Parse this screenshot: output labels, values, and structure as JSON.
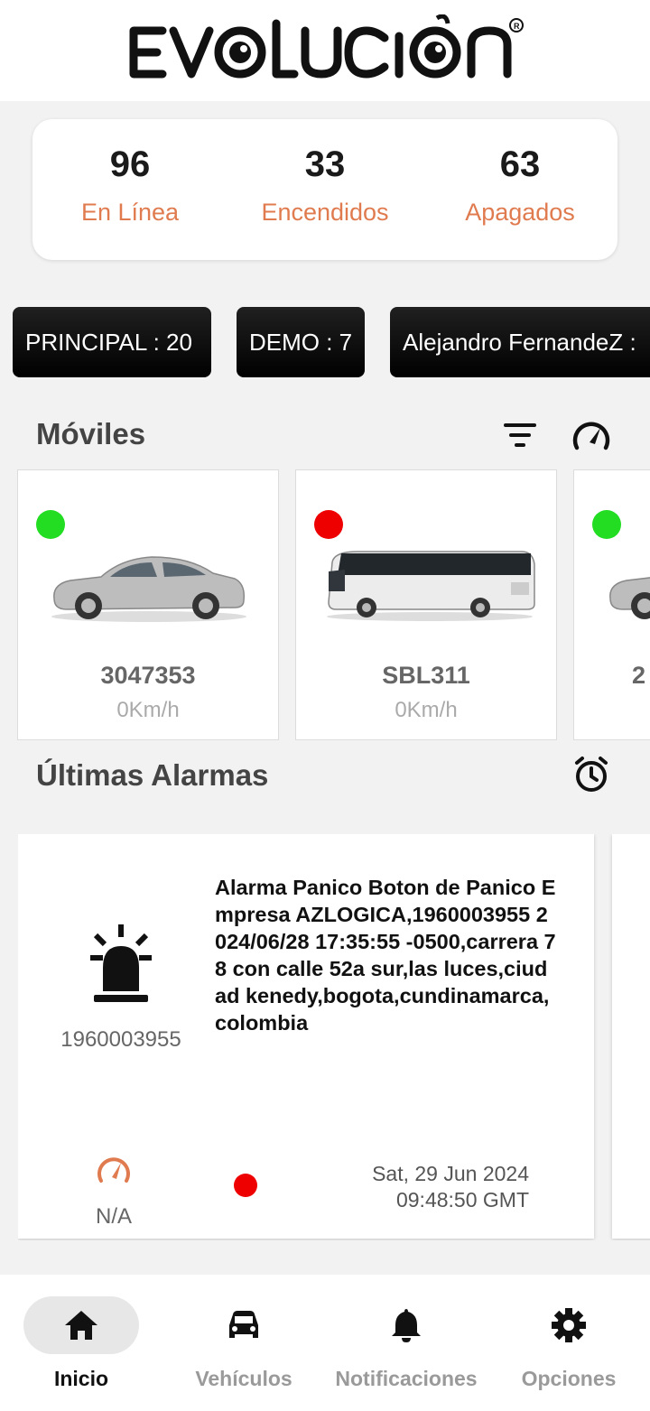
{
  "brand": {
    "logo_text": "EVOLUCIÓN",
    "accent": "#e07b4f"
  },
  "stats": [
    {
      "value": "96",
      "label": "En Línea"
    },
    {
      "value": "33",
      "label": "Encendidos"
    },
    {
      "value": "63",
      "label": "Apagados"
    }
  ],
  "groups": [
    {
      "label": "PRINCIPAL : 20"
    },
    {
      "label": "DEMO : 7"
    },
    {
      "label": "Alejandro FernandeZ :"
    }
  ],
  "mobiles": {
    "title": "Móviles",
    "filter_icon": "filter-icon",
    "speed_icon": "speedometer-icon",
    "items": [
      {
        "plate": "3047353",
        "speed": "0Km/h",
        "status_color": "#22dd22",
        "type": "car"
      },
      {
        "plate": "SBL311",
        "speed": "0Km/h",
        "status_color": "#ee0000",
        "type": "bus"
      },
      {
        "plate": "2",
        "speed": "",
        "status_color": "#22dd22",
        "type": "car"
      }
    ]
  },
  "alarms": {
    "title": "Últimas Alarmas",
    "clock_icon": "alarm-clock-icon",
    "items": [
      {
        "id": "1960003955",
        "text": "Alarma Panico Boton de Panico Empresa AZLOGICA,1960003955 2024/06/28 17:35:55 -0500,carrera 78 con calle 52a sur,las luces,ciudad kenedy,bogota,cundinamarca,colombia",
        "speed": "N/A",
        "date_line1": "Sat, 29 Jun 2024",
        "date_line2": "09:48:50 GMT",
        "status_color": "#ee0000"
      }
    ]
  },
  "nav": [
    {
      "label": "Inicio",
      "icon": "home-icon",
      "active": true
    },
    {
      "label": "Vehículos",
      "icon": "car-icon",
      "active": false
    },
    {
      "label": "Notificaciones",
      "icon": "bell-icon",
      "active": false
    },
    {
      "label": "Opciones",
      "icon": "gear-icon",
      "active": false
    }
  ]
}
